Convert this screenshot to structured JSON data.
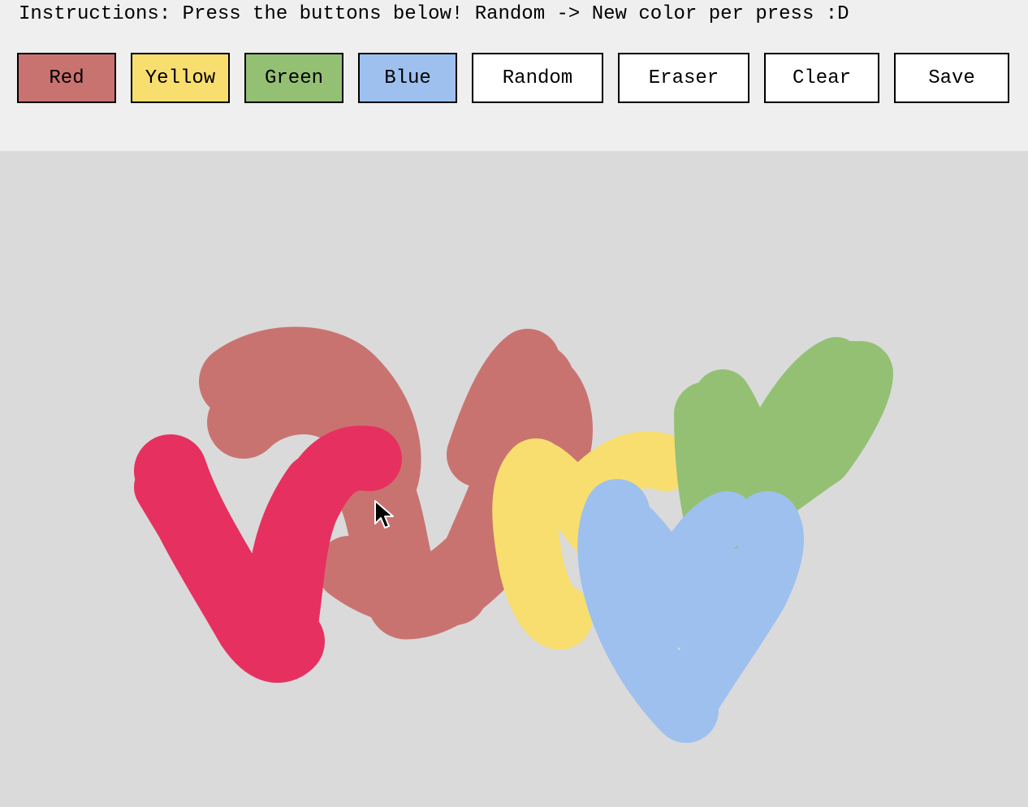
{
  "instructions": "Instructions: Press the buttons below! Random -> New color per press :D",
  "buttons": [
    {
      "name": "red-button",
      "label": "Red",
      "bg": "#c97370"
    },
    {
      "name": "yellow-button",
      "label": "Yellow",
      "bg": "#f8de6e"
    },
    {
      "name": "green-button",
      "label": "Green",
      "bg": "#94c074"
    },
    {
      "name": "blue-button",
      "label": "Blue",
      "bg": "#9ec0ee"
    },
    {
      "name": "random-button",
      "label": "Random",
      "bg": "#ffffff"
    },
    {
      "name": "eraser-button",
      "label": "Eraser",
      "bg": "#ffffff"
    },
    {
      "name": "clear-button",
      "label": "Clear",
      "bg": "#ffffff"
    },
    {
      "name": "save-button",
      "label": "Save",
      "bg": "#ffffff"
    }
  ],
  "canvas": {
    "background": "#dadada",
    "stroke_colors": {
      "red": "#c97370",
      "crimson": "#e63160",
      "yellow": "#f8de6e",
      "green": "#94c074",
      "blue": "#9ec0ee"
    }
  },
  "cursor": {
    "icon": "arrow-cursor-icon"
  }
}
